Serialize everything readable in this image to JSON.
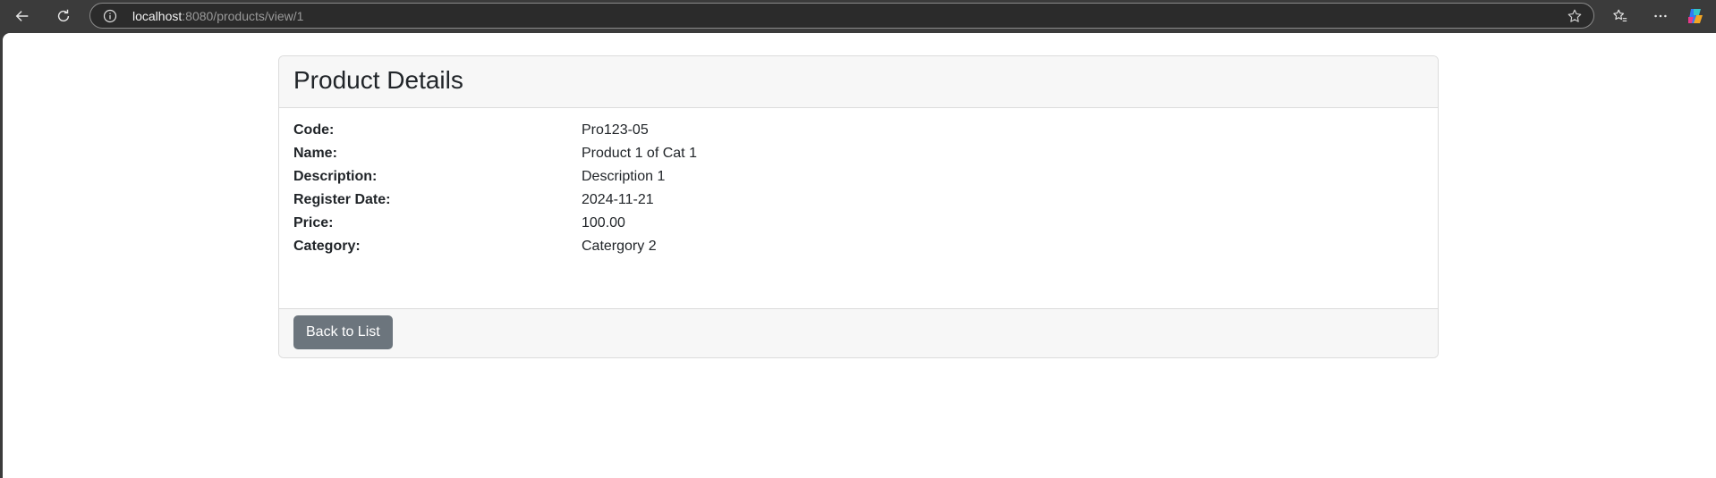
{
  "browser": {
    "url_host": "localhost",
    "url_rest": ":8080/products/view/1"
  },
  "card": {
    "title": "Product Details",
    "fields": [
      {
        "label": "Code:",
        "value": "Pro123-05"
      },
      {
        "label": "Name:",
        "value": "Product 1 of Cat 1"
      },
      {
        "label": "Description:",
        "value": "Description 1"
      },
      {
        "label": "Register Date:",
        "value": "2024-11-21"
      },
      {
        "label": "Price:",
        "value": "100.00"
      },
      {
        "label": "Category:",
        "value": "Catergory 2"
      }
    ],
    "back_button_label": "Back to List"
  },
  "colors": {
    "button_bg": "#6c757d",
    "card_header_bg": "#f7f7f7",
    "chrome_bg": "#3b3b3b"
  }
}
